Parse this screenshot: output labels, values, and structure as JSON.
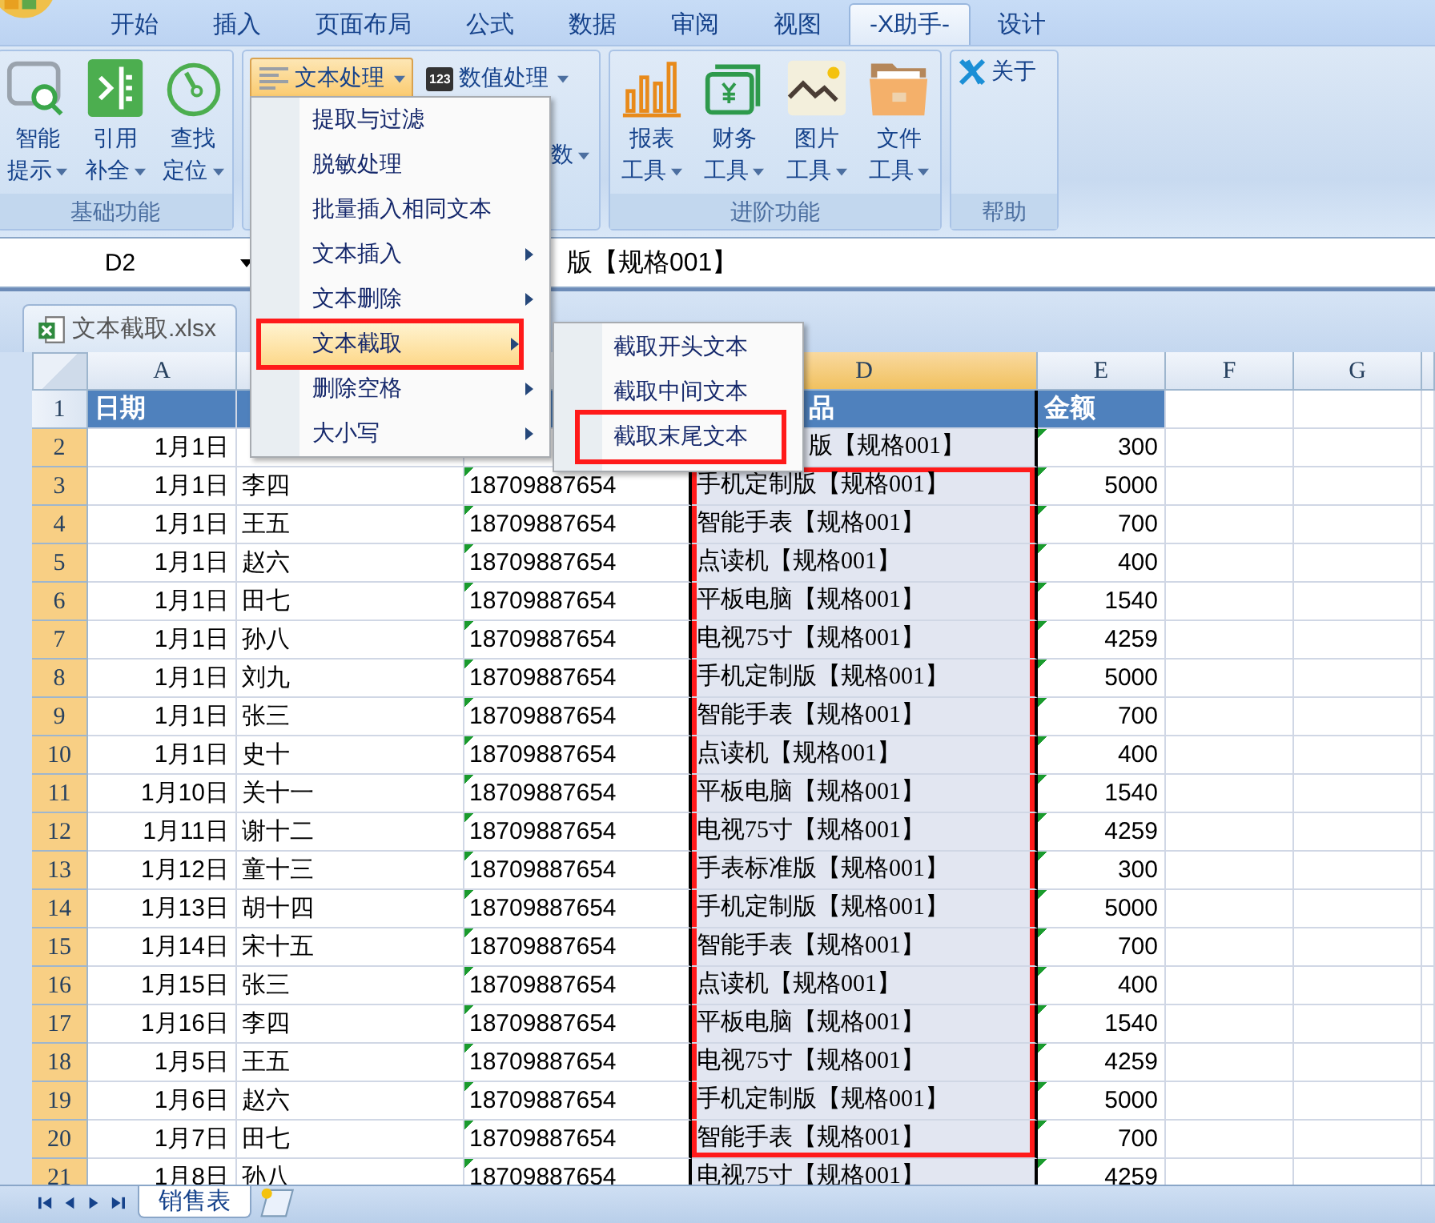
{
  "app_tabs": [
    {
      "label": "开始",
      "selected": false
    },
    {
      "label": "插入",
      "selected": false
    },
    {
      "label": "页面布局",
      "selected": false
    },
    {
      "label": "公式",
      "selected": false
    },
    {
      "label": "数据",
      "selected": false
    },
    {
      "label": "审阅",
      "selected": false
    },
    {
      "label": "视图",
      "selected": false
    },
    {
      "label": "-X助手-",
      "selected": true
    },
    {
      "label": "设计",
      "selected": false
    }
  ],
  "ribbon": {
    "basic": {
      "label": "基础功能",
      "buttons": [
        {
          "kind": "magnifier",
          "line1": "智能",
          "line2": "提示"
        },
        {
          "kind": "bracket",
          "line1": "引用",
          "line2": "补全"
        },
        {
          "kind": "gauge",
          "line1": "查找",
          "line2": "定位"
        }
      ]
    },
    "text_tools": {
      "buttons": [
        {
          "kind": "lines",
          "label": "文本处理",
          "open": true
        },
        {
          "kind": "numbers",
          "badge": "123",
          "label": "数值处理",
          "open": false
        }
      ],
      "partial_label": "数"
    },
    "advanced": {
      "label": "进阶功能",
      "buttons": [
        {
          "kind": "bars",
          "line1": "报表",
          "line2": "工具"
        },
        {
          "kind": "money",
          "line1": "财务",
          "line2": "工具"
        },
        {
          "kind": "image",
          "line1": "图片",
          "line2": "工具"
        },
        {
          "kind": "folder",
          "line1": "文件",
          "line2": "工具"
        }
      ]
    },
    "help": {
      "label": "帮助",
      "button": "关于"
    }
  },
  "formula_bar": {
    "name_box": "D2",
    "value": "版【规格001】"
  },
  "workbook": {
    "title": "文本截取.xlsx"
  },
  "columns": [
    {
      "label": "A",
      "selected": false
    },
    {
      "label": "D",
      "selected": true
    },
    {
      "label": "E",
      "selected": false
    },
    {
      "label": "F",
      "selected": false
    },
    {
      "label": "G",
      "selected": false
    }
  ],
  "rows": [
    {
      "num": "1",
      "kind": "header",
      "selected": false,
      "marked": false,
      "cells": {
        "a": "日期",
        "d": "品",
        "e": "金额"
      },
      "d_covered": true
    },
    {
      "num": "2",
      "kind": "data",
      "selected": true,
      "marked": false,
      "cells": {
        "a": "1月1日",
        "d": "版【规格001】",
        "e": "300"
      },
      "d_covered": true
    },
    {
      "num": "3",
      "kind": "data",
      "selected": true,
      "marked": true,
      "cells": {
        "a": "1月1日",
        "b": "李四",
        "c": "18709887654",
        "d": "手机定制版【规格001】",
        "e": "5000"
      }
    },
    {
      "num": "4",
      "kind": "data",
      "selected": true,
      "marked": true,
      "cells": {
        "a": "1月1日",
        "b": "王五",
        "c": "18709887654",
        "d": "智能手表【规格001】",
        "e": "700"
      }
    },
    {
      "num": "5",
      "kind": "data",
      "selected": true,
      "marked": true,
      "cells": {
        "a": "1月1日",
        "b": "赵六",
        "c": "18709887654",
        "d": "点读机【规格001】",
        "e": "400"
      }
    },
    {
      "num": "6",
      "kind": "data",
      "selected": true,
      "marked": true,
      "cells": {
        "a": "1月1日",
        "b": "田七",
        "c": "18709887654",
        "d": "平板电脑【规格001】",
        "e": "1540"
      }
    },
    {
      "num": "7",
      "kind": "data",
      "selected": true,
      "marked": true,
      "cells": {
        "a": "1月1日",
        "b": "孙八",
        "c": "18709887654",
        "d": "电视75寸【规格001】",
        "e": "4259"
      }
    },
    {
      "num": "8",
      "kind": "data",
      "selected": true,
      "marked": true,
      "cells": {
        "a": "1月1日",
        "b": "刘九",
        "c": "18709887654",
        "d": "手机定制版【规格001】",
        "e": "5000"
      }
    },
    {
      "num": "9",
      "kind": "data",
      "selected": true,
      "marked": true,
      "cells": {
        "a": "1月1日",
        "b": "张三",
        "c": "18709887654",
        "d": "智能手表【规格001】",
        "e": "700"
      }
    },
    {
      "num": "10",
      "kind": "data",
      "selected": true,
      "marked": true,
      "cells": {
        "a": "1月1日",
        "b": "史十",
        "c": "18709887654",
        "d": "点读机【规格001】",
        "e": "400"
      }
    },
    {
      "num": "11",
      "kind": "data",
      "selected": true,
      "marked": true,
      "cells": {
        "a": "1月10日",
        "b": "关十一",
        "c": "18709887654",
        "d": "平板电脑【规格001】",
        "e": "1540"
      }
    },
    {
      "num": "12",
      "kind": "data",
      "selected": true,
      "marked": true,
      "cells": {
        "a": "1月11日",
        "b": "谢十二",
        "c": "18709887654",
        "d": "电视75寸【规格001】",
        "e": "4259"
      }
    },
    {
      "num": "13",
      "kind": "data",
      "selected": true,
      "marked": true,
      "cells": {
        "a": "1月12日",
        "b": "童十三",
        "c": "18709887654",
        "d": "手表标准版【规格001】",
        "e": "300"
      }
    },
    {
      "num": "14",
      "kind": "data",
      "selected": true,
      "marked": true,
      "cells": {
        "a": "1月13日",
        "b": "胡十四",
        "c": "18709887654",
        "d": "手机定制版【规格001】",
        "e": "5000"
      }
    },
    {
      "num": "15",
      "kind": "data",
      "selected": true,
      "marked": true,
      "cells": {
        "a": "1月14日",
        "b": "宋十五",
        "c": "18709887654",
        "d": "智能手表【规格001】",
        "e": "700"
      }
    },
    {
      "num": "16",
      "kind": "data",
      "selected": true,
      "marked": true,
      "cells": {
        "a": "1月15日",
        "b": "张三",
        "c": "18709887654",
        "d": "点读机【规格001】",
        "e": "400"
      }
    },
    {
      "num": "17",
      "kind": "data",
      "selected": true,
      "marked": true,
      "cells": {
        "a": "1月16日",
        "b": "李四",
        "c": "18709887654",
        "d": "平板电脑【规格001】",
        "e": "1540"
      }
    },
    {
      "num": "18",
      "kind": "data",
      "selected": true,
      "marked": true,
      "cells": {
        "a": "1月5日",
        "b": "王五",
        "c": "18709887654",
        "d": "电视75寸【规格001】",
        "e": "4259"
      }
    },
    {
      "num": "19",
      "kind": "data",
      "selected": true,
      "marked": true,
      "cells": {
        "a": "1月6日",
        "b": "赵六",
        "c": "18709887654",
        "d": "手机定制版【规格001】",
        "e": "5000"
      }
    },
    {
      "num": "20",
      "kind": "data",
      "selected": true,
      "marked": true,
      "cells": {
        "a": "1月7日",
        "b": "田七",
        "c": "18709887654",
        "d": "智能手表【规格001】",
        "e": "700"
      }
    },
    {
      "num": "21",
      "kind": "data",
      "selected": true,
      "marked": false,
      "cells": {
        "a": "1月8日",
        "b": "孙八",
        "c": "18709887654",
        "d": "电视75寸【规格001】",
        "e": "4259"
      }
    }
  ],
  "menu": [
    {
      "label": "提取与过滤",
      "submenu": false,
      "highlighted": false,
      "marked": false
    },
    {
      "label": "脱敏处理",
      "submenu": false,
      "highlighted": false,
      "marked": false
    },
    {
      "label": "批量插入相同文本",
      "submenu": false,
      "highlighted": false,
      "marked": false
    },
    {
      "label": "文本插入",
      "submenu": true,
      "highlighted": false,
      "marked": false
    },
    {
      "label": "文本删除",
      "submenu": true,
      "highlighted": false,
      "marked": false
    },
    {
      "label": "文本截取",
      "submenu": true,
      "highlighted": true,
      "marked": true
    },
    {
      "label": "删除空格",
      "submenu": true,
      "highlighted": false,
      "marked": false
    },
    {
      "label": "大小写",
      "submenu": true,
      "highlighted": false,
      "marked": false
    }
  ],
  "submenu": [
    {
      "label": "截取开头文本",
      "marked": false
    },
    {
      "label": "截取中间文本",
      "marked": false
    },
    {
      "label": "截取末尾文本",
      "marked": true
    }
  ],
  "sheet_tabs": [
    {
      "label": "销售表",
      "selected": true
    }
  ]
}
